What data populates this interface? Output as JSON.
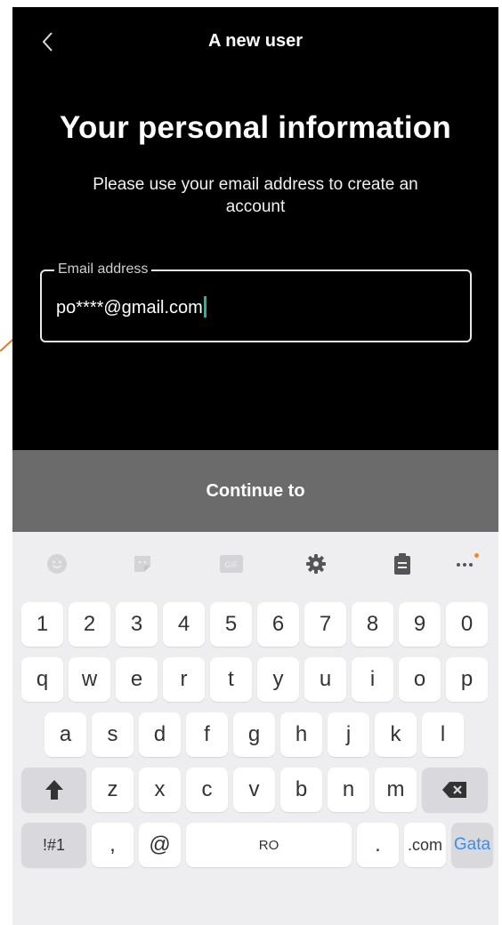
{
  "header": {
    "title": "A new user",
    "back_icon": "chevron-left-icon"
  },
  "heading": "Your personal information",
  "subtitle": "Please use your email address to create an account",
  "email_field": {
    "label": "Email address",
    "value": "po****@gmail.com"
  },
  "continue_label": "Continue to",
  "keyboard": {
    "toolbar": [
      "emoji-icon",
      "sticker-icon",
      "gif-icon",
      "gear-icon",
      "clipboard-icon",
      "more-icon"
    ],
    "gif_label": "GIF",
    "row1": [
      "1",
      "2",
      "3",
      "4",
      "5",
      "6",
      "7",
      "8",
      "9",
      "0"
    ],
    "row2": [
      "q",
      "w",
      "e",
      "r",
      "t",
      "y",
      "u",
      "i",
      "o",
      "p"
    ],
    "row3": [
      "a",
      "s",
      "d",
      "f",
      "g",
      "h",
      "j",
      "k",
      "l"
    ],
    "row4": [
      "z",
      "x",
      "c",
      "v",
      "b",
      "n",
      "m"
    ],
    "symbols_label": "!#1",
    "comma_label": ",",
    "at_label": "@",
    "space_label": "RO",
    "period_label": ".",
    "dotcom_label": ".com",
    "go_label": "Gata"
  },
  "colors": {
    "accent_caret": "#1fb5a5",
    "go_blue": "#3a8ee6",
    "annotation_orange": "#e07b24"
  }
}
